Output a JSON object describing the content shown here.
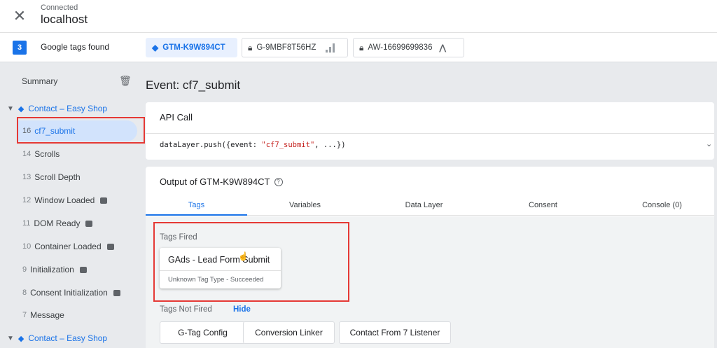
{
  "header": {
    "status": "Connected",
    "host": "localhost"
  },
  "tags_bar": {
    "count": "3",
    "count_label": "Google tags found",
    "chips": [
      {
        "label": "GTM-K9W894CT",
        "active": true
      },
      {
        "label": "G-9MBF8T56HZ",
        "active": false
      },
      {
        "label": "AW-16699699836",
        "active": false
      }
    ]
  },
  "sidebar": {
    "summary": "Summary",
    "group_label": "Contact – Easy Shop",
    "events": [
      {
        "num": "16",
        "label": "cf7_submit"
      },
      {
        "num": "14",
        "label": "Scrolls"
      },
      {
        "num": "13",
        "label": "Scroll Depth"
      },
      {
        "num": "12",
        "label": "Window Loaded"
      },
      {
        "num": "11",
        "label": "DOM Ready"
      },
      {
        "num": "10",
        "label": "Container Loaded"
      },
      {
        "num": "9",
        "label": "Initialization"
      },
      {
        "num": "8",
        "label": "Consent Initialization"
      },
      {
        "num": "7",
        "label": "Message"
      }
    ],
    "group2_label": "Contact – Easy Shop"
  },
  "main": {
    "event_title": "Event: cf7_submit",
    "api_call": {
      "label": "API Call",
      "code_prefix": "dataLayer.push({event: ",
      "code_string": "\"cf7_submit\"",
      "code_suffix": ", ...})"
    },
    "output": {
      "title": "Output of GTM-K9W894CT",
      "tabs": [
        "Tags",
        "Variables",
        "Data Layer",
        "Consent",
        "Console (0)"
      ],
      "tags_fired_label": "Tags Fired",
      "fired_tag": {
        "name": "GAds - Lead Form Submit",
        "status": "Unknown Tag Type - Succeeded"
      },
      "tags_not_fired_label": "Tags Not Fired",
      "hide_label": "Hide",
      "not_fired": [
        "G-Tag Config",
        "Conversion Linker",
        "Contact From 7 Listener"
      ]
    }
  },
  "colors": {
    "accent": "#1a73e8",
    "highlight_border": "#e53935",
    "selected_bg": "#d2e3fc"
  }
}
